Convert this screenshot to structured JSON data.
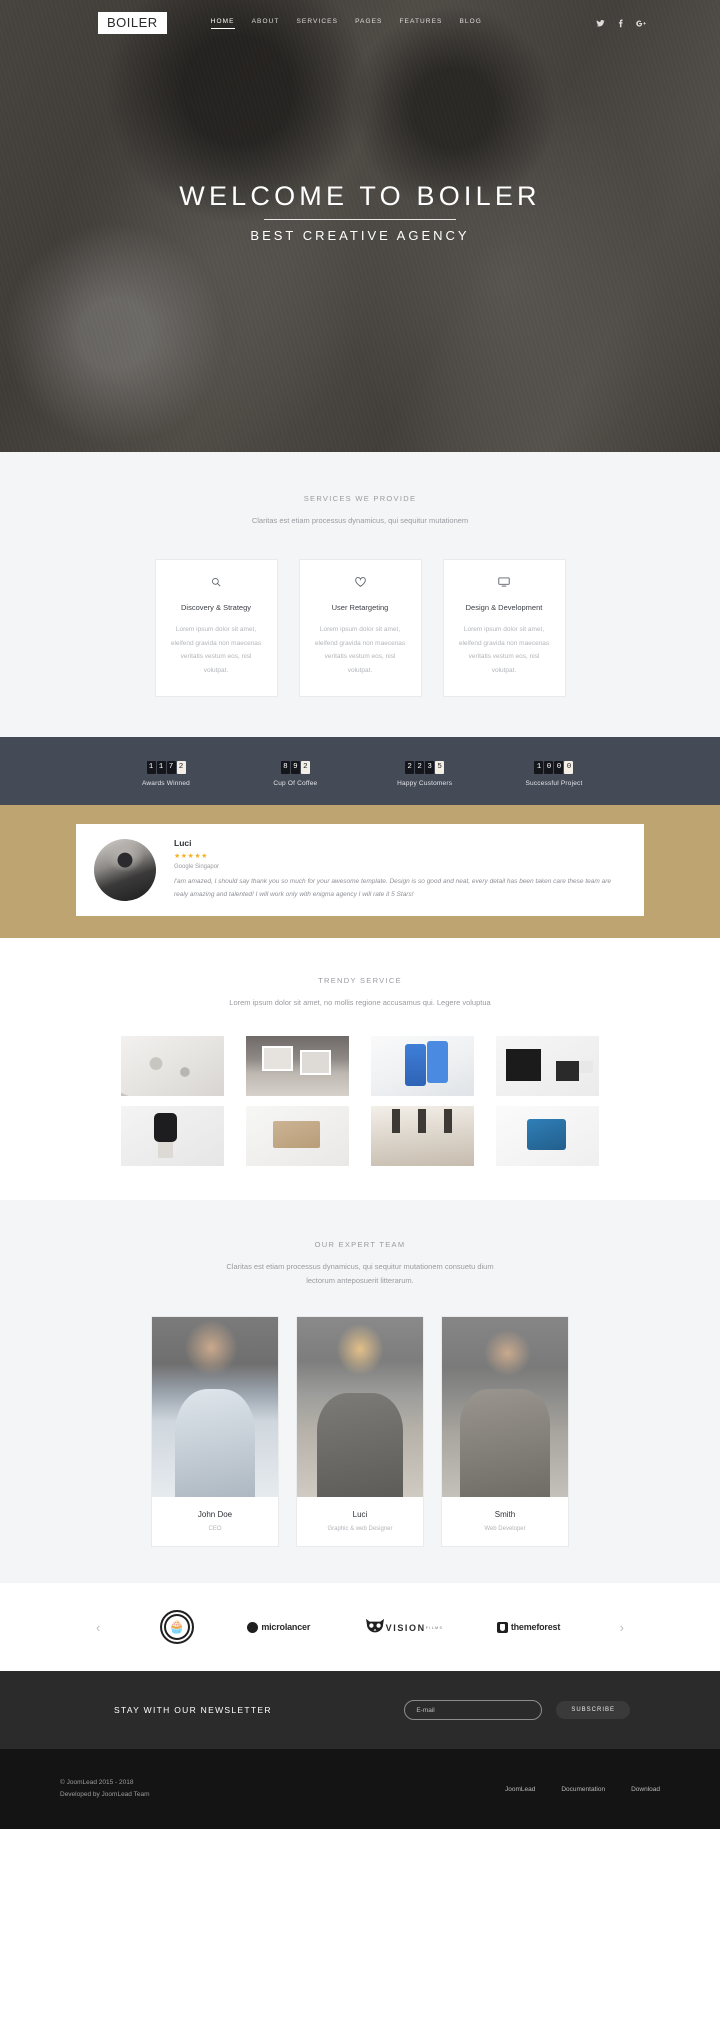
{
  "header": {
    "logo": "BOILER",
    "nav": [
      {
        "label": "HOME",
        "active": true
      },
      {
        "label": "ABOUT",
        "active": false
      },
      {
        "label": "SERVICES",
        "active": false
      },
      {
        "label": "PAGES",
        "active": false
      },
      {
        "label": "FEATURES",
        "active": false
      },
      {
        "label": "BLOG",
        "active": false
      }
    ],
    "socials": [
      "twitter-icon",
      "facebook-icon",
      "google-plus-icon"
    ]
  },
  "hero": {
    "title": "WELCOME TO BOILER",
    "subtitle": "BEST CREATIVE AGENCY"
  },
  "services": {
    "title": "SERVICES WE PROVIDE",
    "subtitle": "Claritas est etiam processus dynamicus, qui sequitur mutationem",
    "cards": [
      {
        "icon": "search-icon",
        "title": "Discovery & Strategy",
        "text": "Lorem ipsum dolor sit amet, eleifend gravida non maecenas veritatis vestum eos, nisl volutpat."
      },
      {
        "icon": "heart-icon",
        "title": "User Retargeting",
        "text": "Lorem ipsum dolor sit amet, eleifend gravida non maecenas veritatis vestum eos, nisl volutpat."
      },
      {
        "icon": "monitor-icon",
        "title": "Design & Development",
        "text": "Lorem ipsum dolor sit amet, eleifend gravida non maecenas veritatis vestum eos, nisl volutpat."
      }
    ]
  },
  "counters": [
    {
      "value": "1172",
      "label": "Awards Winned"
    },
    {
      "value": "892",
      "label": "Cup Of Coffee"
    },
    {
      "value": "2235",
      "label": "Happy Customers"
    },
    {
      "value": "1000",
      "label": "Successful Project"
    }
  ],
  "testimonial": {
    "name": "Luci",
    "stars": "★★★★★",
    "role": "Google Singapor",
    "quote": "I'am amazed, I should say thank you so much for your awesome template. Design is so good and neat, every detail has been taken care these team are realy amazing and talented! I will work only with enigma agency  I will rate it 5 Stars!"
  },
  "trendy": {
    "title": "TRENDY SERVICE",
    "subtitle": "Lorem ipsum dolor sit amet, no mollis regione accusamus qui. Legere voluptua",
    "tiles": [
      "stationery-mockup",
      "living-room-frames",
      "phone-app-mockup",
      "business-card-set",
      "smart-watch-mockup",
      "kraft-box-mockup",
      "interior-kitchen",
      "blue-mug-mockup"
    ]
  },
  "team": {
    "title": "OUR EXPERT TEAM",
    "subtitle_line1": "Claritas est etiam processus dynamicus, qui sequitur mutationem consuetu dium",
    "subtitle_line2": "lectorum anteposuerit litterarum.",
    "members": [
      {
        "name": "John Doe",
        "role": "CEO"
      },
      {
        "name": "Luci",
        "role": "Graphic & web Designer"
      },
      {
        "name": "Smith",
        "role": "Web Developer"
      }
    ]
  },
  "logos": {
    "prev": "‹",
    "next": "›",
    "brands": [
      {
        "name": "cupcake-badge-logo",
        "label": ""
      },
      {
        "name": "microlancer-logo",
        "label": "microlancer"
      },
      {
        "name": "vision-films-logo",
        "label": "VISION",
        "sublabel": "FILMS"
      },
      {
        "name": "themeforest-logo",
        "label": "themeforest"
      }
    ]
  },
  "newsletter": {
    "title": "STAY WITH OUR NEWSLETTER",
    "placeholder": "E-mail",
    "value": "",
    "button": "SUBSCRIBE"
  },
  "footer": {
    "copyright_line1": "© JoomLead 2015 - 2018",
    "copyright_line2": "Developed by JoomLead Team",
    "links": [
      "JoomLead",
      "Documentation",
      "Download"
    ]
  },
  "colors": {
    "accent_gold": "#bea471",
    "counters_bg": "#454a57",
    "footer_bg": "#141414",
    "newsletter_bg": "#2b2b2b",
    "star_gold": "#f0b429"
  }
}
